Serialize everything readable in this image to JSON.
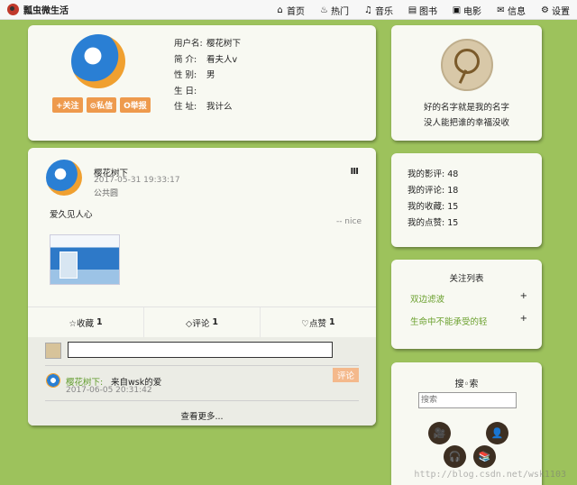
{
  "topbar": {
    "app_title": "瓢虫微生活",
    "nav": [
      {
        "icon": "home-icon",
        "glyph": "⌂",
        "label": "首页"
      },
      {
        "icon": "fire-icon",
        "glyph": "♨",
        "label": "热门"
      },
      {
        "icon": "headphones-icon",
        "glyph": "♫",
        "label": "音乐"
      },
      {
        "icon": "book-icon",
        "glyph": "▤",
        "label": "图书"
      },
      {
        "icon": "film-icon",
        "glyph": "▣",
        "label": "电影"
      },
      {
        "icon": "mail-icon",
        "glyph": "✉",
        "label": "信息"
      },
      {
        "icon": "gear-icon",
        "glyph": "⚙",
        "label": "设置"
      }
    ]
  },
  "profile": {
    "buttons": {
      "follow": "+关注",
      "message": "⊙私信",
      "report": "O举报"
    },
    "info": [
      {
        "key": "用户名:",
        "value": "樱花树下"
      },
      {
        "key": "简  介:",
        "value": "看夫人v"
      },
      {
        "key": "性  别:",
        "value": "男"
      },
      {
        "key": "生  日:",
        "value": ""
      },
      {
        "key": "住  址:",
        "value": "我计么"
      }
    ]
  },
  "post": {
    "author": "樱花树下",
    "time": "2017-05-31 19:33:17",
    "area": "公共圆",
    "menu_glyph": "Ⅲ",
    "text": "爱久见人心",
    "sign": "-- nice",
    "stats": [
      {
        "label": "☆收藏",
        "count": "1"
      },
      {
        "label": "◇评论",
        "count": "1"
      },
      {
        "label": "♡点赞",
        "count": "1"
      }
    ],
    "comment_placeholder": "",
    "comment_button": "评论",
    "comment": {
      "author": "樱花树下:",
      "text": "来自wsk的爱",
      "time": "2017-06-05 20:31:42"
    },
    "more": "查看更多..."
  },
  "signature": {
    "line1": "好的名字就是我的名字",
    "line2": "没人能把谁的幸福没收"
  },
  "counts": [
    {
      "label": "我的影评:",
      "value": "48"
    },
    {
      "label": "我的评论:",
      "value": "18"
    },
    {
      "label": "我的收藏:",
      "value": "15"
    },
    {
      "label": "我的点赞:",
      "value": "15"
    }
  ],
  "follow": {
    "title": "关注列表",
    "items": [
      {
        "name": "双边滤波",
        "action": "+"
      },
      {
        "name": "生命中不能承受的轻",
        "action": "+"
      }
    ]
  },
  "search": {
    "title": "搜◦索",
    "placeholder": "搜索",
    "icons": [
      "movie-camera-icon",
      "user-icon",
      "headset-icon",
      "books-icon"
    ],
    "glyphs": [
      "🎥",
      "👤",
      "🎧",
      "📚"
    ]
  },
  "watermark": "http://blog.csdn.net/wsk1103"
}
